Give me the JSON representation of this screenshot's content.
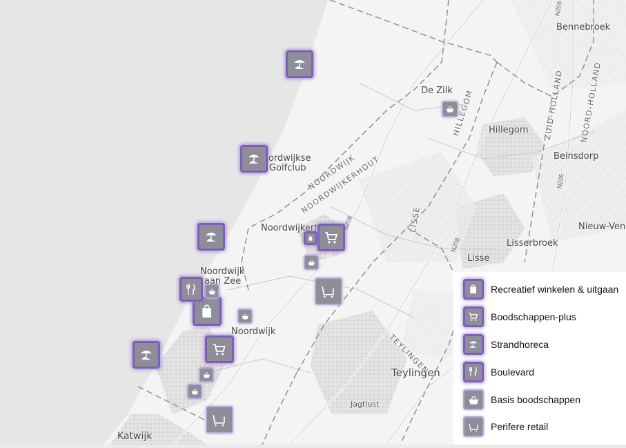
{
  "map": {
    "places": {
      "bennebroek": "Bennebroek",
      "de_zilk": "De Zilk",
      "hillegom": "Hillegom",
      "beinsdorp": "Beinsdorp",
      "noordwijkse_golfclub_1": "oordwijkse",
      "noordwijkse_golfclub_2": "Golfclub",
      "noordwijkerhout": "Noordwijkerho",
      "noordwijk_aan_zee_1": "Noordwijk",
      "noordwijk_aan_zee_2": "aan Zee",
      "noordwijk": "Noordwijk",
      "lisserbroek": "Lisserbroek",
      "lisse": "Lisse",
      "nieuw_vennep": "Nieuw-Venn",
      "teylingen": "Teylingen",
      "jagtlust": "Jagtlust",
      "katwijk": "Katwijk"
    },
    "areas": {
      "noordwijk": "NOORDWIJK",
      "noordwijkerhout": "NOORDWIJKERHOUT",
      "hillegom": "HILLEGOM",
      "zuid_holland": "ZUID-HOLLAND",
      "noord_holland": "NOORD-HOLLAND",
      "lisse": "LISSE",
      "teylingen": "TEYLINGEN"
    },
    "roads": {
      "n206_a": "N206",
      "n206_b": "N206",
      "n208": "N208",
      "n205": "N205"
    }
  },
  "legend": {
    "items": [
      {
        "label": "Recreatief winkelen & uitgaan",
        "icon": "shopping-bag-icon"
      },
      {
        "label": "Boodschappen-plus",
        "icon": "shopping-cart-icon"
      },
      {
        "label": "Strandhoreca",
        "icon": "beach-umbrella-icon"
      },
      {
        "label": "Boulevard",
        "icon": "fork-knife-icon"
      },
      {
        "label": "Basis boodschappen",
        "icon": "basket-icon"
      },
      {
        "label": "Perifere retail",
        "icon": "trolley-icon"
      }
    ]
  },
  "colors": {
    "sea": "#e6e6e6",
    "land": "#f4f4f4",
    "marker_fill": "#8e8e9a",
    "marker_border": "#7d5fb3",
    "marker_glow": "#9a78d2"
  }
}
